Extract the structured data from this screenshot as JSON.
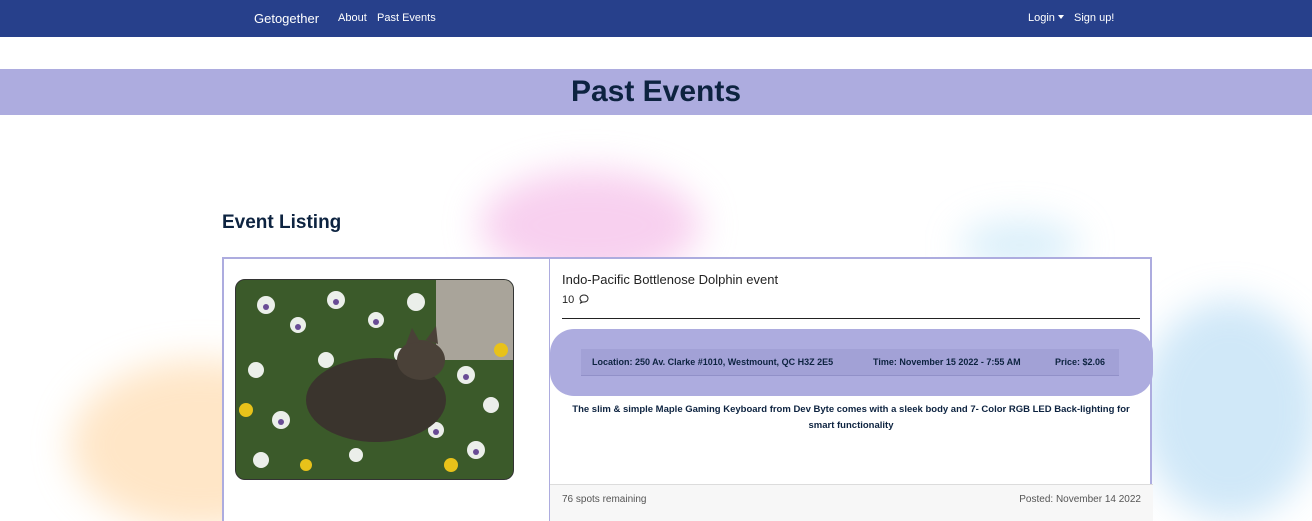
{
  "nav": {
    "brand": "Getogether",
    "about": "About",
    "past_events": "Past Events",
    "login": "Login",
    "signup": "Sign up!"
  },
  "page": {
    "title": "Past Events",
    "section_heading": "Event Listing"
  },
  "event": {
    "title": "Indo-Pacific Bottlenose Dolphin event",
    "comment_count": "10",
    "location": "Location: 250 Av. Clarke #1010, Westmount, QC H3Z 2E5",
    "time": "Time: November 15 2022 - 7:55 AM",
    "price": "Price: $2.06",
    "description": "The slim & simple Maple Gaming Keyboard from Dev Byte comes with a sleek body and 7- Color RGB LED Back-lighting for smart functionality",
    "spots": "76 spots remaining",
    "posted": "Posted: November 14 2022"
  },
  "colors": {
    "navbar": "#27408b",
    "banner": "#adacdf",
    "heading": "#0d2340"
  }
}
